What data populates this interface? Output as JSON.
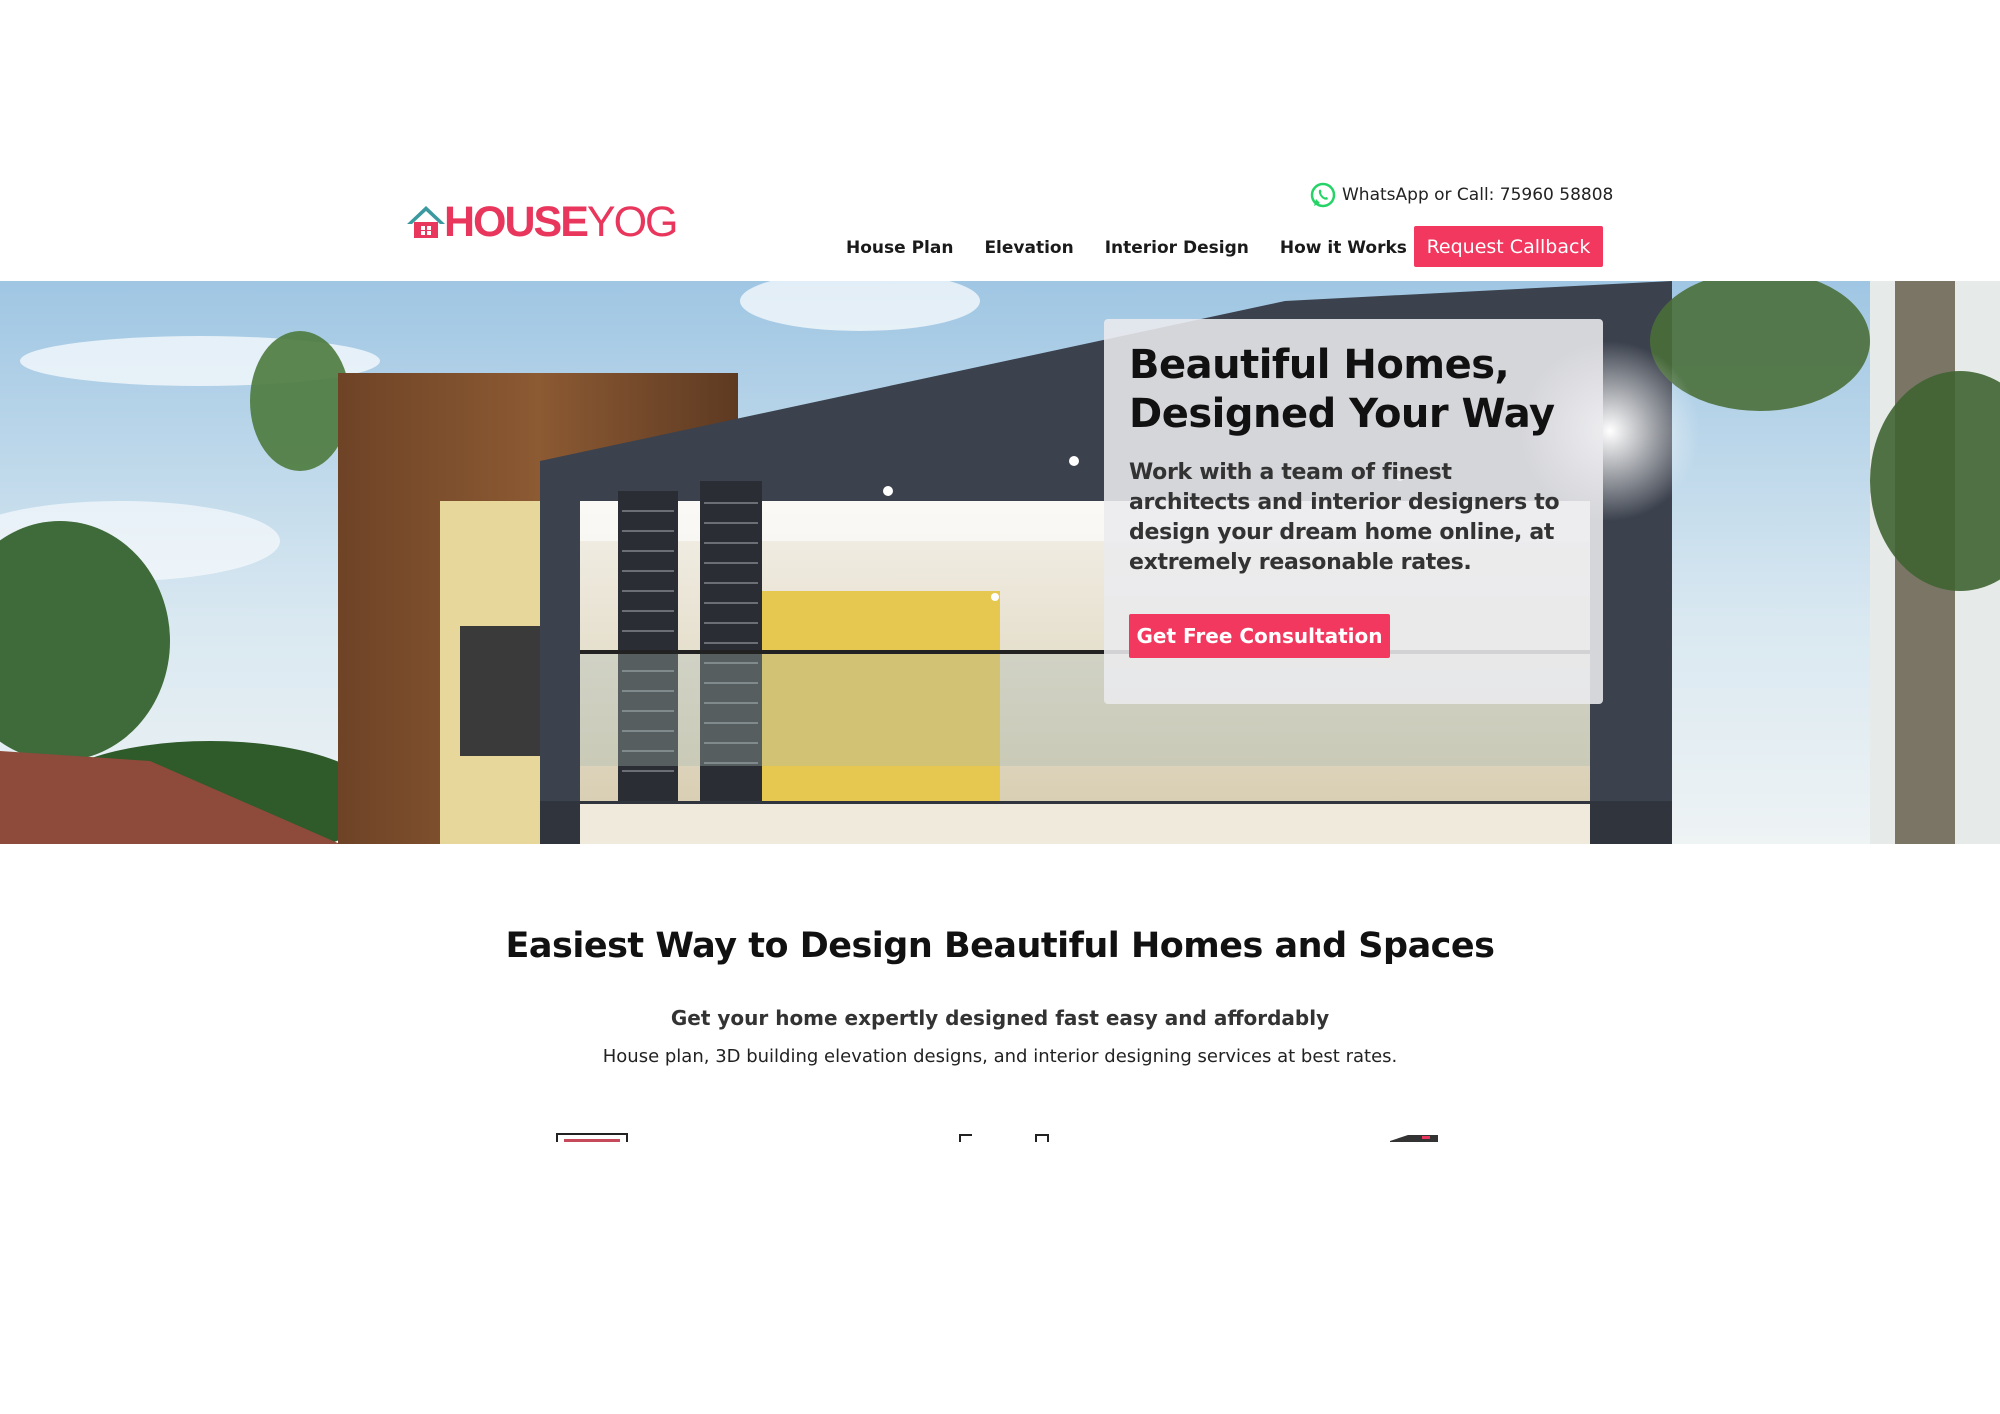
{
  "brand": {
    "logo_part1": "HOUSE",
    "logo_part2": "YOG",
    "accent_color": "#f2385e"
  },
  "header": {
    "contact_label": "WhatsApp or Call: 75960 58808",
    "contact_icon": "whatsapp-icon",
    "nav": [
      {
        "label": "House Plan"
      },
      {
        "label": "Elevation"
      },
      {
        "label": "Interior Design"
      },
      {
        "label": "How it Works"
      }
    ],
    "callback_label": "Request Callback"
  },
  "hero": {
    "title": "Beautiful Homes, Designed Your Way",
    "text": "Work with a team of finest architects and interior designers to design your dream home online, at extremely reasonable rates.",
    "cta_label": "Get Free Consultation"
  },
  "intro": {
    "heading": "Easiest Way to Design Beautiful Homes and Spaces",
    "subheading": "Get your home expertly designed fast easy and affordably",
    "description": "House plan, 3D building elevation designs, and interior designing services at best rates."
  }
}
